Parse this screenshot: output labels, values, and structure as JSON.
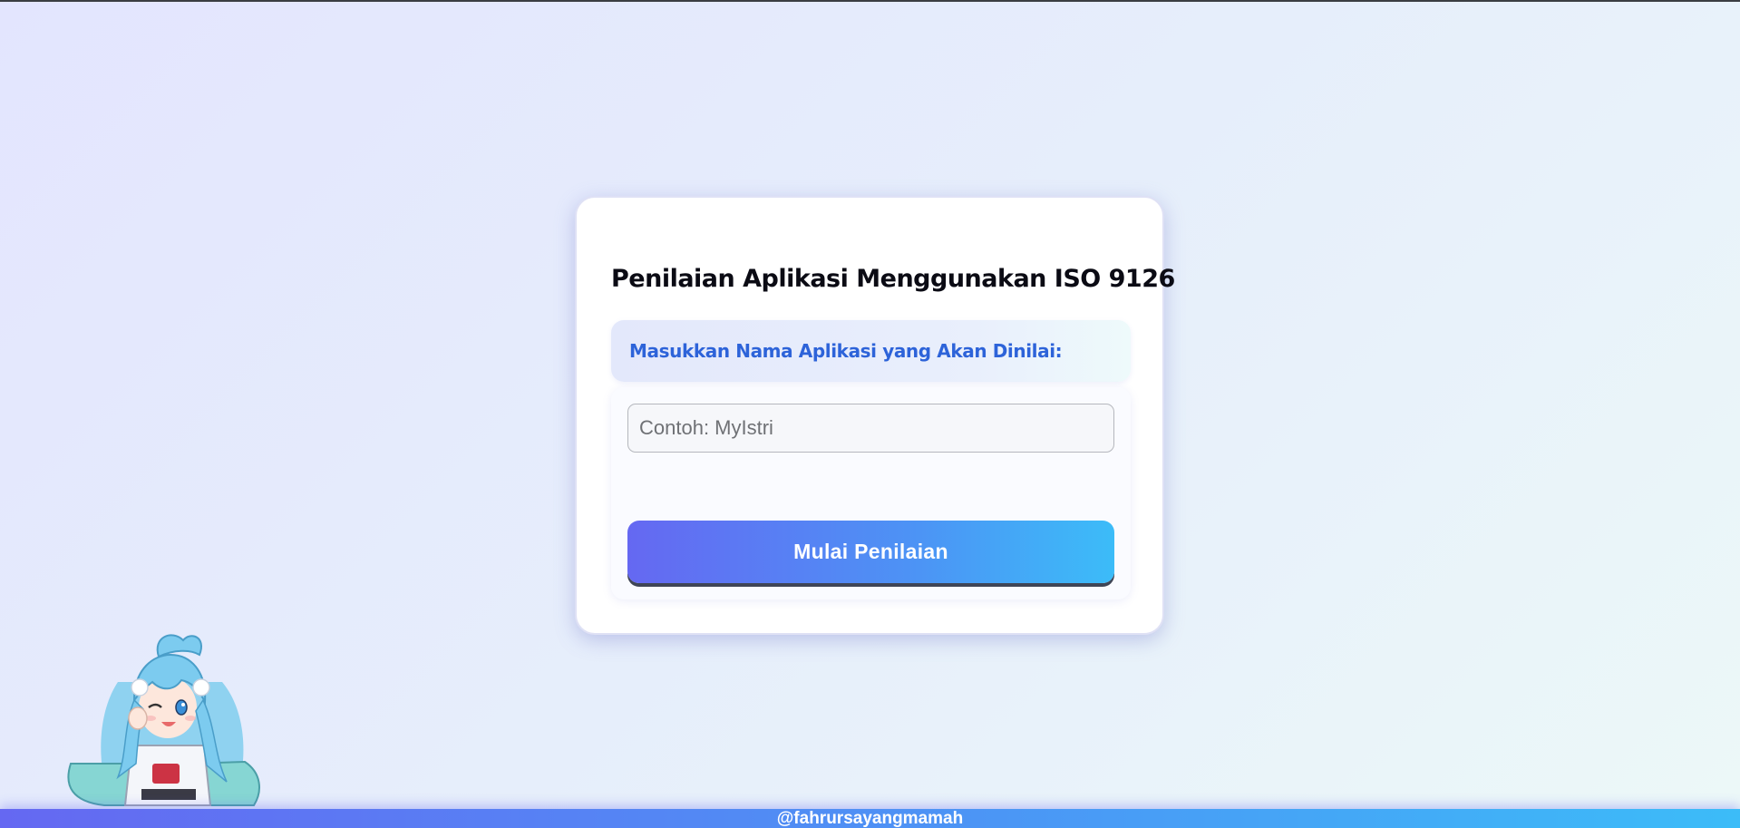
{
  "app": {
    "title": "Penilaian Aplikasi Menggunakan ISO 9126"
  },
  "form": {
    "label": "Masukkan Nama Aplikasi yang Akan Dinilai:",
    "app_name_value": "",
    "app_name_placeholder": "Contoh: MyIstri",
    "submit_label": "Mulai Penilaian"
  },
  "footer": {
    "credit": "@fahrursayangmamah"
  },
  "mascot": {
    "icon": "anime-character-illustration"
  },
  "colors": {
    "accent_start": "#6568f2",
    "accent_end": "#3cbcf8",
    "label_text": "#2d63d9",
    "title_text": "#0b0b14"
  }
}
